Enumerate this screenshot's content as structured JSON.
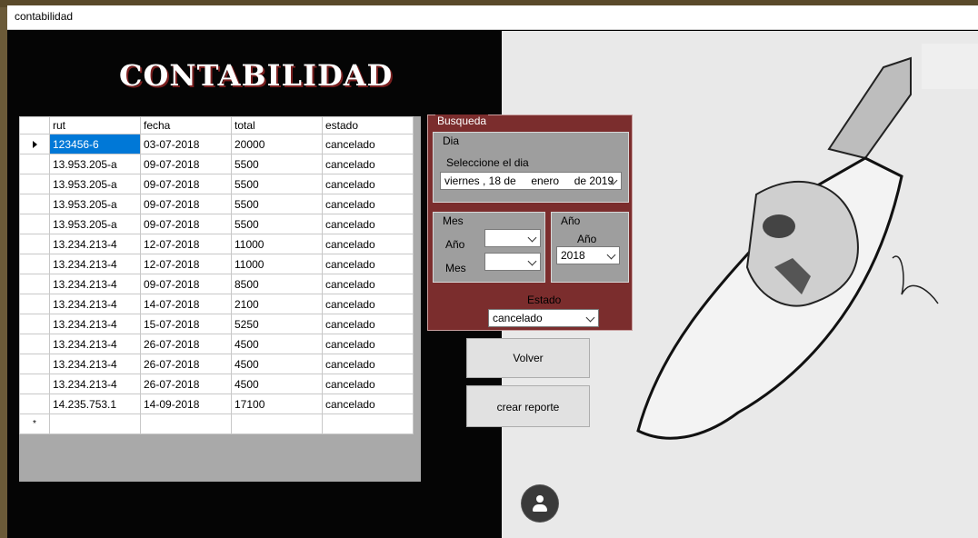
{
  "window": {
    "title": "contabilidad"
  },
  "page": {
    "heading": "CONTABILIDAD"
  },
  "grid": {
    "columns": [
      "rut",
      "fecha",
      "total",
      "estado"
    ],
    "rows": [
      [
        "123456-6",
        "03-07-2018",
        "20000",
        "cancelado"
      ],
      [
        "13.953.205-a",
        "09-07-2018",
        "5500",
        "cancelado"
      ],
      [
        "13.953.205-a",
        "09-07-2018",
        "5500",
        "cancelado"
      ],
      [
        "13.953.205-a",
        "09-07-2018",
        "5500",
        "cancelado"
      ],
      [
        "13.953.205-a",
        "09-07-2018",
        "5500",
        "cancelado"
      ],
      [
        "13.234.213-4",
        "12-07-2018",
        "11000",
        "cancelado"
      ],
      [
        "13.234.213-4",
        "12-07-2018",
        "11000",
        "cancelado"
      ],
      [
        "13.234.213-4",
        "09-07-2018",
        "8500",
        "cancelado"
      ],
      [
        "13.234.213-4",
        "14-07-2018",
        "2100",
        "cancelado"
      ],
      [
        "13.234.213-4",
        "15-07-2018",
        "5250",
        "cancelado"
      ],
      [
        "13.234.213-4",
        "26-07-2018",
        "4500",
        "cancelado"
      ],
      [
        "13.234.213-4",
        "26-07-2018",
        "4500",
        "cancelado"
      ],
      [
        "13.234.213-4",
        "26-07-2018",
        "4500",
        "cancelado"
      ],
      [
        "14.235.753.1",
        "14-09-2018",
        "17100",
        "cancelado"
      ]
    ],
    "new_row_marker": "*"
  },
  "busqueda": {
    "title": "Busqueda",
    "dia": {
      "legend": "Dia",
      "label": "Seleccione el dia",
      "date_value": "viernes , 18 de     enero     de 2019"
    },
    "mes": {
      "legend": "Mes",
      "label_ano": "Año",
      "label_mes": "Mes",
      "ano_value": "",
      "mes_value": ""
    },
    "ano": {
      "legend": "Año",
      "label": "Año",
      "value": "2018"
    },
    "estado": {
      "label": "Estado",
      "value": "cancelado"
    }
  },
  "buttons": {
    "volver": "Volver",
    "crear_reporte": "crear reporte"
  },
  "icons": {
    "user": "user-icon"
  },
  "colors": {
    "panel": "#7b2d2d",
    "selection": "#0078d7"
  }
}
